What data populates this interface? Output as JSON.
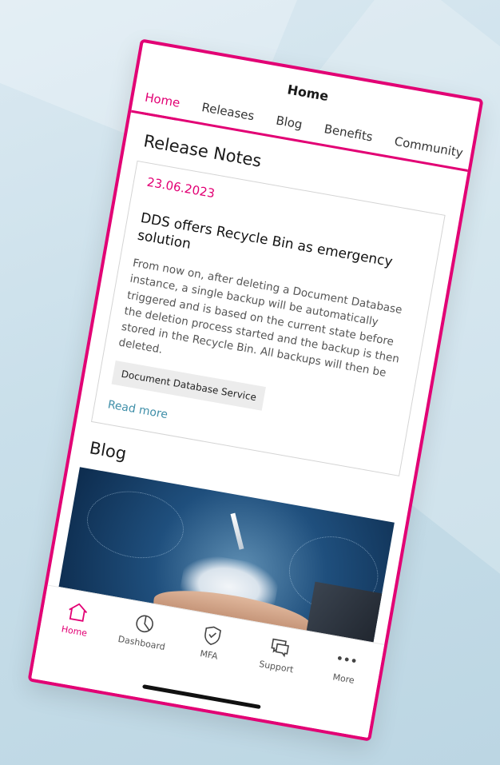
{
  "app": {
    "title": "Home"
  },
  "tabs": [
    {
      "label": "Home",
      "active": true
    },
    {
      "label": "Releases",
      "active": false
    },
    {
      "label": "Blog",
      "active": false
    },
    {
      "label": "Benefits",
      "active": false
    },
    {
      "label": "Community",
      "active": false
    }
  ],
  "release_notes": {
    "title": "Release Notes",
    "date": "23.06.2023",
    "headline": "DDS offers Recycle Bin as emergency solution",
    "body": "From now on, after deleting a Document Database instance, a single backup will be automatically triggered and is based on the current state before the deletion process started and the backup is then stored in the Recycle Bin. All backups will then be deleted.",
    "tag": "Document Database Service",
    "read_more": "Read more"
  },
  "blog": {
    "title": "Blog"
  },
  "bottom_nav": [
    {
      "label": "Home",
      "icon": "home-icon",
      "active": true
    },
    {
      "label": "Dashboard",
      "icon": "pie-chart-icon",
      "active": false
    },
    {
      "label": "MFA",
      "icon": "shield-check-icon",
      "active": false
    },
    {
      "label": "Support",
      "icon": "chat-bubble-icon",
      "active": false
    },
    {
      "label": "More",
      "icon": "more-dots-icon",
      "active": false
    }
  ],
  "colors": {
    "accent": "#e20074",
    "link": "#3e8ea8"
  }
}
